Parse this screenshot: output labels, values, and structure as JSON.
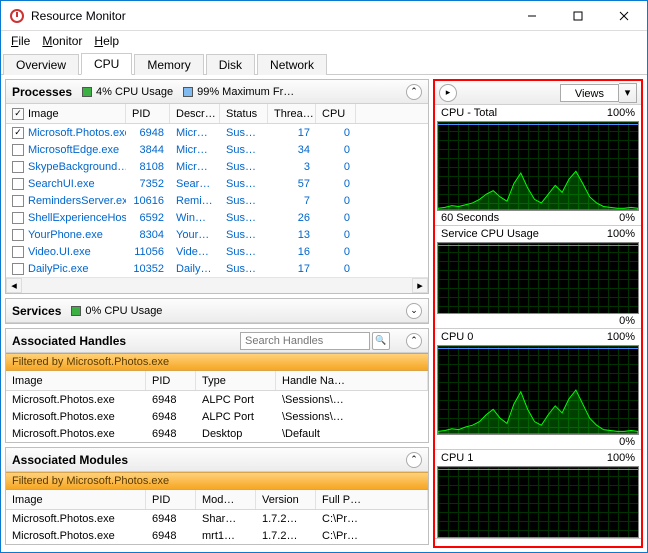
{
  "window": {
    "title": "Resource Monitor"
  },
  "menu": {
    "file": "File",
    "monitor": "Monitor",
    "help": "Help"
  },
  "tabs": {
    "overview": "Overview",
    "cpu": "CPU",
    "memory": "Memory",
    "disk": "Disk",
    "network": "Network"
  },
  "processes": {
    "title": "Processes",
    "cpu_usage": "4% CPU Usage",
    "max_freq": "99% Maximum Fr…",
    "cols": {
      "image": "Image",
      "pid": "PID",
      "desc": "Descr…",
      "status": "Status",
      "threads": "Threa…",
      "cpu": "CPU"
    },
    "rows": [
      {
        "image": "Microsoft.Photos.exe",
        "pid": "6948",
        "desc": "Micr…",
        "status": "Susp…",
        "threads": "17",
        "cpu": "0",
        "checked": true
      },
      {
        "image": "MicrosoftEdge.exe",
        "pid": "3844",
        "desc": "Micr…",
        "status": "Susp…",
        "threads": "34",
        "cpu": "0",
        "checked": false
      },
      {
        "image": "SkypeBackground…",
        "pid": "8108",
        "desc": "Micr…",
        "status": "Susp…",
        "threads": "3",
        "cpu": "0",
        "checked": false
      },
      {
        "image": "SearchUI.exe",
        "pid": "7352",
        "desc": "Searc…",
        "status": "Susp…",
        "threads": "57",
        "cpu": "0",
        "checked": false
      },
      {
        "image": "RemindersServer.exe",
        "pid": "10616",
        "desc": "Remi…",
        "status": "Susp…",
        "threads": "7",
        "cpu": "0",
        "checked": false
      },
      {
        "image": "ShellExperienceHos…",
        "pid": "6592",
        "desc": "Win…",
        "status": "Susp…",
        "threads": "26",
        "cpu": "0",
        "checked": false
      },
      {
        "image": "YourPhone.exe",
        "pid": "8304",
        "desc": "Your…",
        "status": "Susp…",
        "threads": "13",
        "cpu": "0",
        "checked": false
      },
      {
        "image": "Video.UI.exe",
        "pid": "11056",
        "desc": "Vide…",
        "status": "Susp…",
        "threads": "16",
        "cpu": "0",
        "checked": false
      },
      {
        "image": "DailyPic.exe",
        "pid": "10352",
        "desc": "Daily…",
        "status": "Susp…",
        "threads": "17",
        "cpu": "0",
        "checked": false
      }
    ]
  },
  "services": {
    "title": "Services",
    "cpu_usage": "0% CPU Usage"
  },
  "handles": {
    "title": "Associated Handles",
    "search_placeholder": "Search Handles",
    "filter": "Filtered by Microsoft.Photos.exe",
    "cols": {
      "image": "Image",
      "pid": "PID",
      "type": "Type",
      "hname": "Handle Na…"
    },
    "rows": [
      {
        "image": "Microsoft.Photos.exe",
        "pid": "6948",
        "type": "ALPC Port",
        "hname": "\\Sessions\\…"
      },
      {
        "image": "Microsoft.Photos.exe",
        "pid": "6948",
        "type": "ALPC Port",
        "hname": "\\Sessions\\…"
      },
      {
        "image": "Microsoft.Photos.exe",
        "pid": "6948",
        "type": "Desktop",
        "hname": "\\Default"
      }
    ]
  },
  "modules": {
    "title": "Associated Modules",
    "filter": "Filtered by Microsoft.Photos.exe",
    "cols": {
      "image": "Image",
      "pid": "PID",
      "mod": "Mod…",
      "ver": "Version",
      "path": "Full P…"
    },
    "rows": [
      {
        "image": "Microsoft.Photos.exe",
        "pid": "6948",
        "mod": "Shar…",
        "ver": "1.7.2…",
        "path": "C:\\Pr…"
      },
      {
        "image": "Microsoft.Photos.exe",
        "pid": "6948",
        "mod": "mrt1…",
        "ver": "1.7.2…",
        "path": "C:\\Pr…"
      }
    ]
  },
  "chartpanel": {
    "views": "Views",
    "charts": [
      {
        "name": "CPU - Total",
        "pct": "100%",
        "foot_l": "60 Seconds",
        "foot_r": "0%",
        "big": true,
        "wave": true
      },
      {
        "name": "Service CPU Usage",
        "pct": "100%",
        "foot_l": "",
        "foot_r": "0%",
        "big": false,
        "wave": false
      },
      {
        "name": "CPU 0",
        "pct": "100%",
        "foot_l": "",
        "foot_r": "0%",
        "big": true,
        "wave": true
      },
      {
        "name": "CPU 1",
        "pct": "100%",
        "foot_l": "",
        "foot_r": "",
        "big": false,
        "wave": false
      }
    ]
  },
  "chart_data": [
    {
      "type": "line",
      "title": "CPU - Total",
      "ylim": [
        0,
        100
      ],
      "x_seconds": 60,
      "values_pct": [
        2,
        3,
        5,
        4,
        6,
        8,
        12,
        18,
        22,
        15,
        10,
        30,
        42,
        25,
        12,
        8,
        18,
        28,
        20,
        35,
        44,
        30,
        15,
        8,
        4,
        3,
        2,
        2,
        3,
        2
      ]
    },
    {
      "type": "line",
      "title": "Service CPU Usage",
      "ylim": [
        0,
        100
      ],
      "x_seconds": 60,
      "values_pct": [
        0,
        0,
        0,
        0,
        0,
        0,
        0,
        0,
        0,
        0,
        0,
        0,
        0,
        0,
        0,
        0,
        0,
        0,
        0,
        0,
        0,
        0,
        0,
        0,
        0,
        0,
        0,
        0,
        0,
        0
      ]
    },
    {
      "type": "line",
      "title": "CPU 0",
      "ylim": [
        0,
        100
      ],
      "x_seconds": 60,
      "values_pct": [
        3,
        4,
        6,
        5,
        8,
        10,
        14,
        22,
        28,
        18,
        12,
        34,
        48,
        28,
        14,
        10,
        22,
        32,
        24,
        40,
        50,
        34,
        18,
        10,
        5,
        4,
        3,
        3,
        4,
        3
      ]
    },
    {
      "type": "line",
      "title": "CPU 1",
      "ylim": [
        0,
        100
      ],
      "x_seconds": 60,
      "values_pct": []
    }
  ]
}
